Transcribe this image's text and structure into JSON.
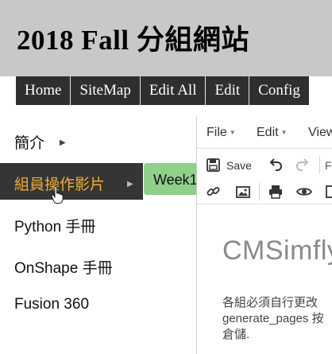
{
  "site": {
    "title": "2018 Fall 分組網站"
  },
  "topnav": {
    "items": [
      "Home",
      "SiteMap",
      "Edit All",
      "Edit",
      "Config"
    ]
  },
  "sidemenu": {
    "items": [
      {
        "label": "簡介"
      },
      {
        "label": "組員操作影片",
        "active": true
      },
      {
        "label": "Python 手冊"
      },
      {
        "label": "OnShape 手冊"
      },
      {
        "label": "Fusion 360"
      }
    ],
    "submenu": {
      "label": "Week1"
    }
  },
  "editor": {
    "menubar": {
      "file": "File",
      "edit": "Edit",
      "view": "View"
    },
    "toolbar": {
      "save": "Save",
      "r_fragment": "F"
    },
    "content": {
      "title": "CMSimfly",
      "body_line1": "各組必須自行更改",
      "body_line2": "generate_pages 按",
      "body_line3": "倉儲."
    }
  },
  "colors": {
    "header_bg": "#c8c8c8",
    "nav_bg": "#2f2f2f",
    "active_text": "#f0b030",
    "submenu_bg": "#8fd08a"
  }
}
